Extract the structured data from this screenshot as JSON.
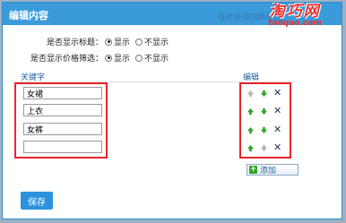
{
  "dialog": {
    "title": "编辑内容",
    "background_text": "在此处添加新标签",
    "watermark": {
      "title": "淘巧网",
      "subtitle": "taoqao.com"
    }
  },
  "settings": {
    "show_title": {
      "label": "是否显示标题：",
      "options": [
        "显示",
        "不显示"
      ],
      "selected": "显示"
    },
    "show_price_filter": {
      "label": "是否显示价格筛选：",
      "options": [
        "显示",
        "不显示"
      ],
      "selected": "显示"
    }
  },
  "table": {
    "keyword_header": "关键字",
    "edit_header": "编辑",
    "rows": [
      {
        "keyword": "女裙",
        "up_enabled": false,
        "down_enabled": true
      },
      {
        "keyword": "上衣",
        "up_enabled": true,
        "down_enabled": true
      },
      {
        "keyword": "女裤",
        "up_enabled": true,
        "down_enabled": true
      },
      {
        "keyword": "",
        "up_enabled": true,
        "down_enabled": false
      }
    ]
  },
  "add_label": "添加",
  "save_label": "保存",
  "colors": {
    "titlebar": "#3b9ad9",
    "highlight": "#e8262b",
    "arrow_green": "#2fa52a",
    "arrow_gray": "#b5b5b5"
  }
}
